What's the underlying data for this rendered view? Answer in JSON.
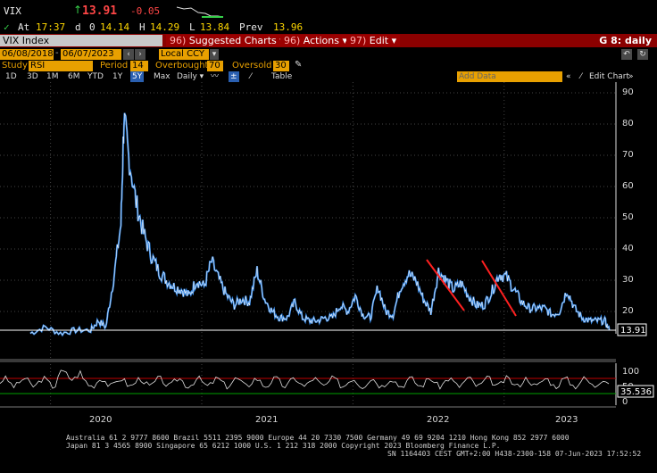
{
  "header": {
    "ticker": "VIX",
    "arrow": "↑",
    "last": "13.91",
    "change": "-0.05",
    "at_label": "At",
    "time": "17:37",
    "d_label": "d",
    "open_label": "0",
    "open": "14.14",
    "high_label": "H",
    "high": "14.29",
    "low_label": "L",
    "low": "13.84",
    "prev_label": "Prev",
    "prev": "13.96"
  },
  "toolbar": {
    "index_name": "VIX Index",
    "tabs": [
      {
        "code": "96)",
        "label": "Suggested Charts ▾"
      },
      {
        "code": "96)",
        "label": "Actions ▾"
      },
      {
        "code": "97)",
        "label": "Edit ▾"
      }
    ],
    "right_label": "G 8: daily"
  },
  "daterange": {
    "start": "06/08/2018",
    "end": "06/07/2023",
    "currency": "Local CCY"
  },
  "study": {
    "study_label": "Study",
    "study_value": "RSI",
    "period_label": "Period",
    "period_value": "14",
    "overbought_label": "Overbought",
    "overbought_value": "70",
    "oversold_label": "Oversold",
    "oversold_value": "30"
  },
  "periods": {
    "items": [
      "1D",
      "3D",
      "1M",
      "6M",
      "YTD",
      "1Y",
      "5Y",
      "Max",
      "Daily ▾"
    ],
    "selected": "5Y",
    "table_label": "Table",
    "add_data_placeholder": "Add Data",
    "edit_chart_label": "Edit Chart"
  },
  "chart_data": {
    "type": "line",
    "price_axis": {
      "ticks": [
        "90",
        "80",
        "70",
        "60",
        "50",
        "40",
        "30",
        "20"
      ],
      "ylim": [
        10,
        92
      ]
    },
    "rsi_axis": {
      "ticks": [
        "100",
        "50",
        "0"
      ],
      "ylim": [
        0,
        100
      ],
      "overbought": 70,
      "oversold": 30
    },
    "x_labels": [
      "2020",
      "2021",
      "2022",
      "2023"
    ],
    "last_price_label": "13.91",
    "last_rsi_label": "35.536",
    "series": [
      {
        "values": [
          [
            2019.6,
            13
          ],
          [
            2019.7,
            15
          ],
          [
            2019.8,
            13
          ],
          [
            2019.9,
            14
          ],
          [
            2020.0,
            14
          ],
          [
            2020.05,
            17
          ],
          [
            2020.1,
            15
          ],
          [
            2020.15,
            30
          ],
          [
            2020.2,
            48
          ],
          [
            2020.22,
            82
          ],
          [
            2020.25,
            70
          ],
          [
            2020.3,
            55
          ],
          [
            2020.35,
            45
          ],
          [
            2020.4,
            38
          ],
          [
            2020.45,
            33
          ],
          [
            2020.5,
            30
          ],
          [
            2020.55,
            28
          ],
          [
            2020.6,
            27
          ],
          [
            2020.65,
            25
          ],
          [
            2020.7,
            30
          ],
          [
            2020.75,
            28
          ],
          [
            2020.8,
            36
          ],
          [
            2020.85,
            30
          ],
          [
            2020.9,
            25
          ],
          [
            2020.95,
            22
          ],
          [
            2021.0,
            24
          ],
          [
            2021.05,
            23
          ],
          [
            2021.1,
            33
          ],
          [
            2021.15,
            24
          ],
          [
            2021.2,
            20
          ],
          [
            2021.25,
            18
          ],
          [
            2021.3,
            18
          ],
          [
            2021.35,
            23
          ],
          [
            2021.4,
            18
          ],
          [
            2021.45,
            17
          ],
          [
            2021.5,
            17
          ],
          [
            2021.55,
            18
          ],
          [
            2021.6,
            18
          ],
          [
            2021.65,
            22
          ],
          [
            2021.7,
            20
          ],
          [
            2021.75,
            25
          ],
          [
            2021.8,
            19
          ],
          [
            2021.85,
            18
          ],
          [
            2021.9,
            28
          ],
          [
            2021.95,
            20
          ],
          [
            2022.0,
            19
          ],
          [
            2022.05,
            28
          ],
          [
            2022.1,
            32
          ],
          [
            2022.15,
            30
          ],
          [
            2022.2,
            24
          ],
          [
            2022.25,
            20
          ],
          [
            2022.3,
            33
          ],
          [
            2022.35,
            30
          ],
          [
            2022.4,
            27
          ],
          [
            2022.45,
            29
          ],
          [
            2022.5,
            25
          ],
          [
            2022.55,
            22
          ],
          [
            2022.6,
            22
          ],
          [
            2022.65,
            26
          ],
          [
            2022.7,
            32
          ],
          [
            2022.75,
            31
          ],
          [
            2022.8,
            27
          ],
          [
            2022.85,
            23
          ],
          [
            2022.9,
            21
          ],
          [
            2022.95,
            21
          ],
          [
            2023.0,
            21
          ],
          [
            2023.05,
            19
          ],
          [
            2023.1,
            20
          ],
          [
            2023.15,
            27
          ],
          [
            2023.2,
            21
          ],
          [
            2023.25,
            18
          ],
          [
            2023.3,
            17
          ],
          [
            2023.35,
            17
          ],
          [
            2023.4,
            17
          ],
          [
            2023.43,
            13.91
          ]
        ]
      }
    ]
  }
}
